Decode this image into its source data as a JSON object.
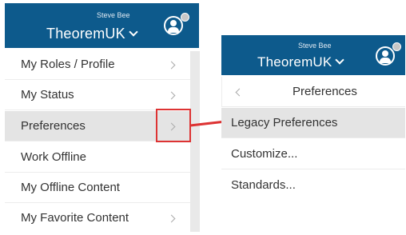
{
  "left_menu": {
    "user_name": "Steve Bee",
    "org_name": "TheoremUK",
    "items": [
      {
        "label": "My Roles / Profile",
        "has_submenu": true
      },
      {
        "label": "My Status",
        "has_submenu": true
      },
      {
        "label": "Preferences",
        "has_submenu": true
      },
      {
        "label": "Work Offline",
        "has_submenu": false
      },
      {
        "label": "My Offline Content",
        "has_submenu": false
      },
      {
        "label": "My Favorite Content",
        "has_submenu": true
      }
    ]
  },
  "right_menu": {
    "user_name": "Steve Bee",
    "org_name": "TheoremUK",
    "back_title": "Preferences",
    "items": [
      {
        "label": "Legacy Preferences"
      },
      {
        "label": "Customize..."
      },
      {
        "label": "Standards..."
      }
    ]
  },
  "colors": {
    "header_bg": "#0d5a8c",
    "callout": "#dd3333",
    "highlight": "#e4e4e4"
  }
}
